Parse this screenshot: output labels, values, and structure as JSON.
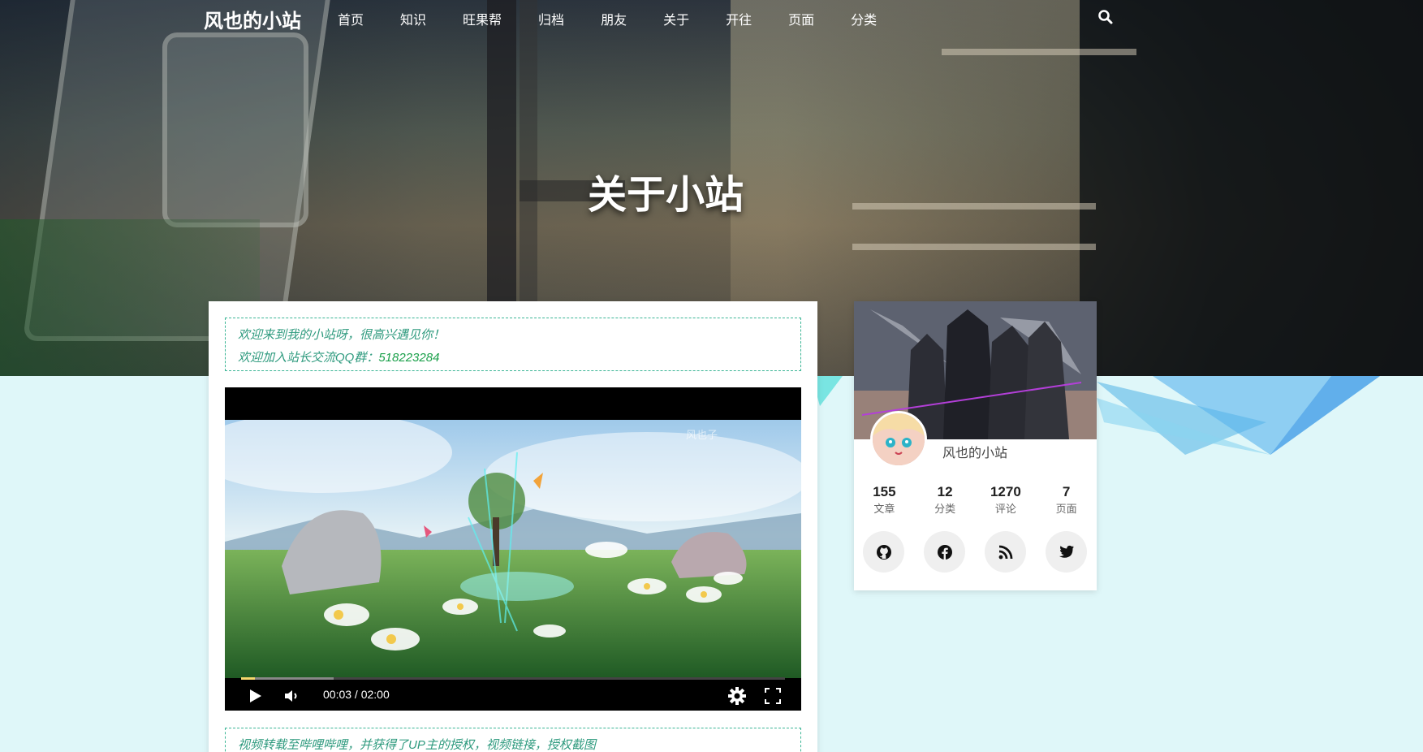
{
  "site": {
    "brand": "风也的小站"
  },
  "nav": {
    "items": [
      "首页",
      "知识",
      "旺果帮",
      "归档",
      "朋友",
      "关于",
      "开往",
      "页面",
      "分类"
    ],
    "search_icon": "search-icon"
  },
  "hero": {
    "title": "关于小站"
  },
  "notice_top": {
    "line1": "欢迎来到我的小站呀，很高兴遇见你！",
    "line2_prefix": "欢迎加入站长交流QQ群：",
    "qq_number": "518223284"
  },
  "video": {
    "time": "00:03 / 02:00",
    "watermark": "风也子",
    "progress_played": 0.025,
    "progress_buffered": 0.17
  },
  "notice_bottom": {
    "text": "视频转载至哔哩哔哩，并获得了UP主的授权，视频链接，授权截图"
  },
  "profile": {
    "name": "风也的小站",
    "stats": [
      {
        "num": "155",
        "label": "文章"
      },
      {
        "num": "12",
        "label": "分类"
      },
      {
        "num": "1270",
        "label": "评论"
      },
      {
        "num": "7",
        "label": "页面"
      }
    ],
    "socials": [
      "github-icon",
      "facebook-icon",
      "rss-icon",
      "twitter-icon"
    ]
  },
  "colors": {
    "accent": "#3bb595",
    "notice_text": "#2e9a7e",
    "qq_text": "#1aa04a",
    "page_bg": "#dff7f9"
  }
}
